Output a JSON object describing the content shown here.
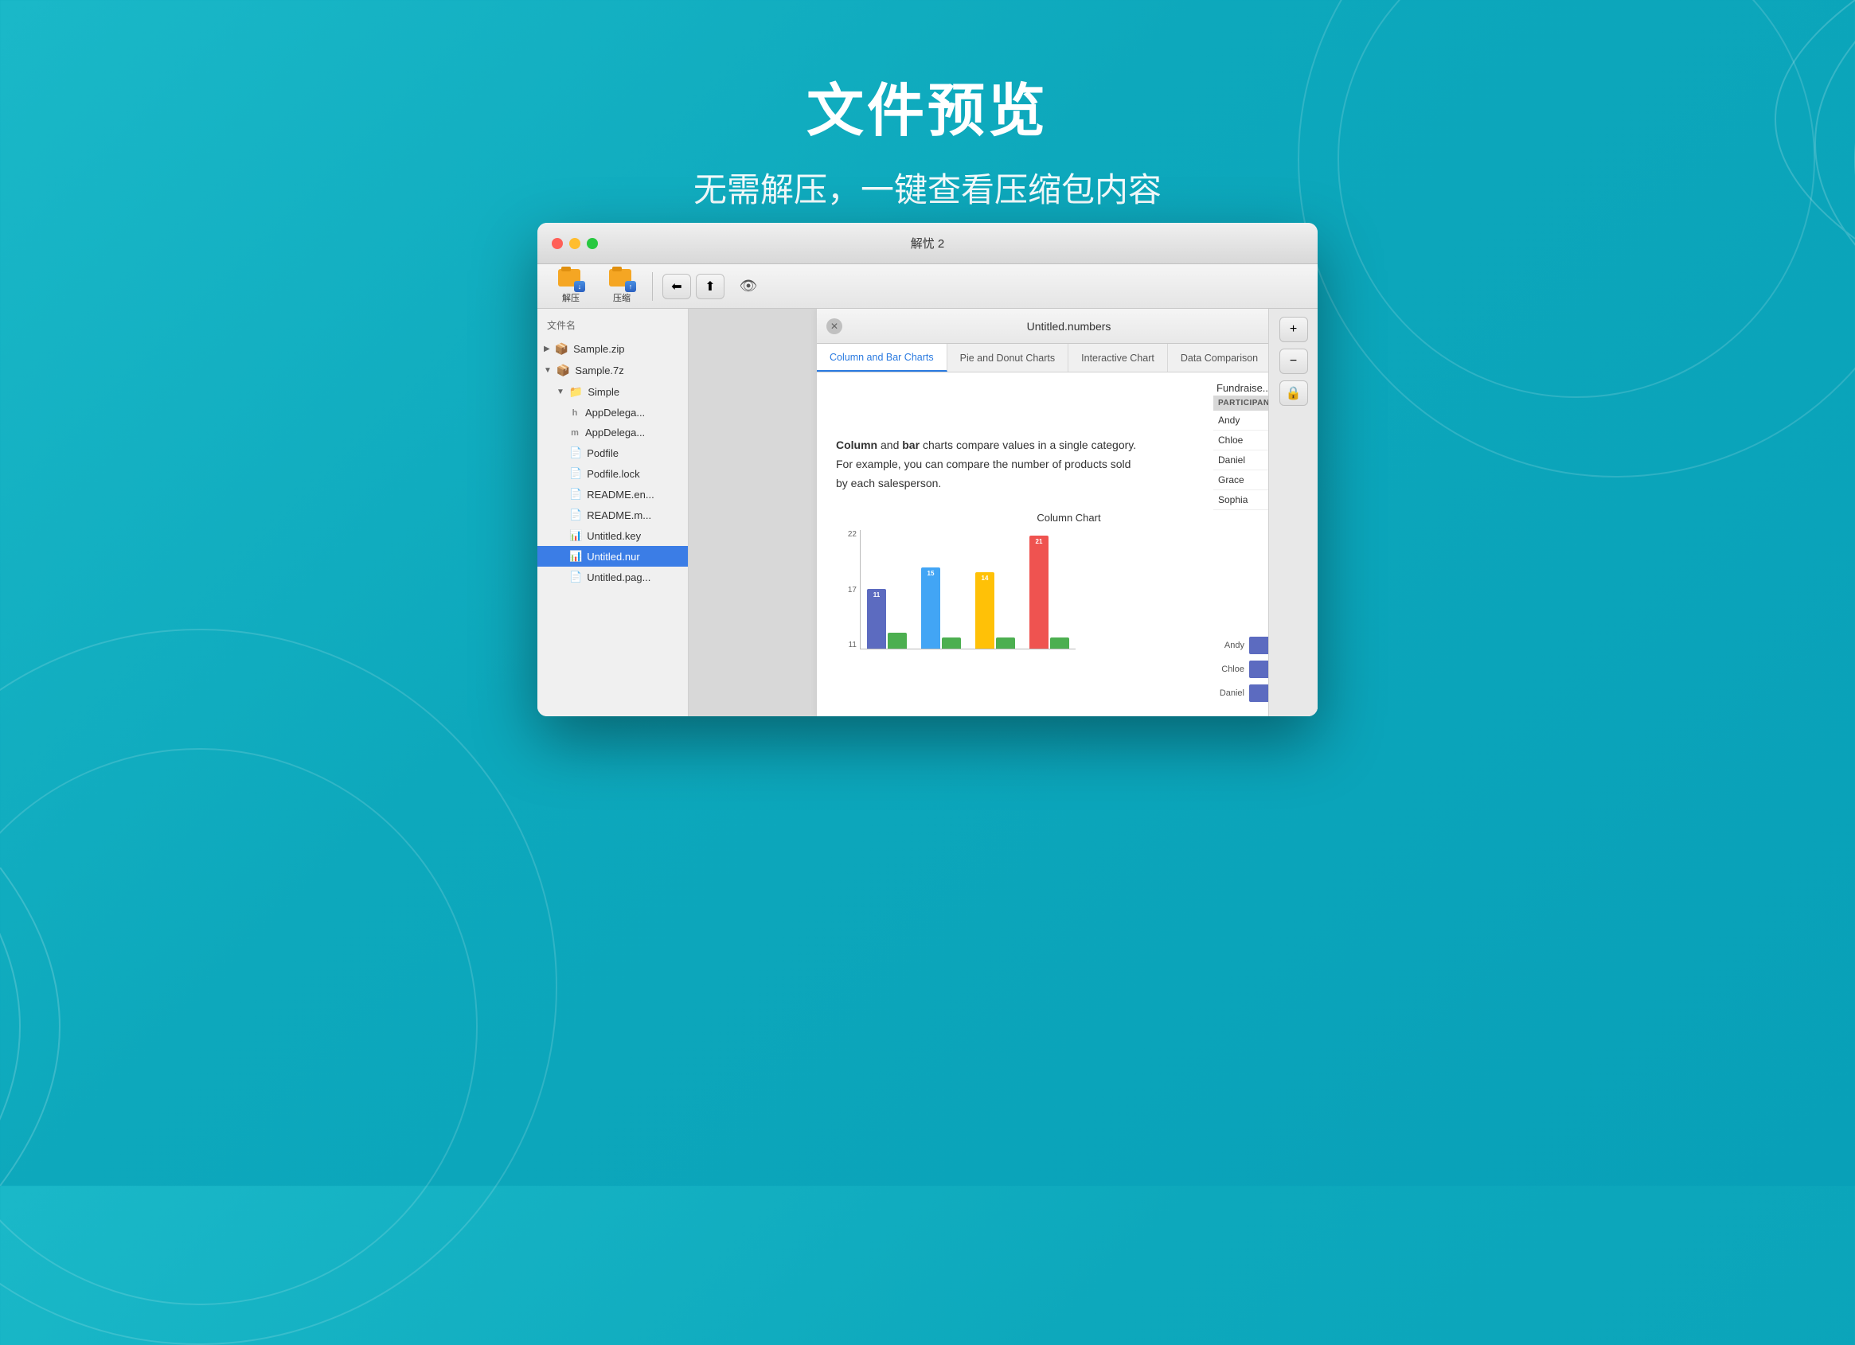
{
  "page": {
    "title": "文件预览",
    "subtitle": "无需解压，一键查看压缩包内容"
  },
  "main_window": {
    "title": "解忧 2"
  },
  "toolbar": {
    "decompress_label": "解压",
    "compress_label": "压缩"
  },
  "file_list": {
    "header": "文件名",
    "items": [
      {
        "name": "Sample.zip",
        "type": "zip",
        "indent": 0,
        "expanded": false
      },
      {
        "name": "Sample.7z",
        "type": "7z",
        "indent": 0,
        "expanded": true
      },
      {
        "name": "Simple",
        "type": "folder",
        "indent": 1,
        "expanded": true
      },
      {
        "name": "AppDelega...",
        "type": "h",
        "indent": 2
      },
      {
        "name": "AppDelega...",
        "type": "m",
        "indent": 2
      },
      {
        "name": "Podfile",
        "type": "file",
        "indent": 2
      },
      {
        "name": "Podfile.lock",
        "type": "file",
        "indent": 2
      },
      {
        "name": "README.en...",
        "type": "md",
        "indent": 2
      },
      {
        "name": "README.m...",
        "type": "md",
        "indent": 2
      },
      {
        "name": "Untitled.key",
        "type": "key",
        "indent": 2
      },
      {
        "name": "Untitled.nur",
        "type": "numbers",
        "indent": 2,
        "selected": true
      },
      {
        "name": "Untitled.pag...",
        "type": "pages",
        "indent": 2
      }
    ]
  },
  "numbers_window": {
    "title": "Untitled.numbers",
    "close_label": "✕",
    "tabs": [
      {
        "label": "Column and Bar Charts",
        "active": true
      },
      {
        "label": "Pie and Donut Charts",
        "active": false
      },
      {
        "label": "Interactive Chart",
        "active": false
      },
      {
        "label": "Data Comparison",
        "active": false
      }
    ],
    "description": "Column and bar charts compare values in a single category. For example, you can compare the number of products sold by each salesperson.",
    "chart_title": "Column Chart",
    "chart": {
      "y_labels": [
        "22",
        "17",
        "11"
      ],
      "bar_groups": [
        {
          "bars": [
            {
              "value": 11,
              "color": "#5c6bc0",
              "label": "11",
              "height_pct": 50
            },
            {
              "value": 3,
              "color": "#4caf50",
              "label": "",
              "height_pct": 14
            }
          ]
        },
        {
          "bars": [
            {
              "value": 15,
              "color": "#42a5f5",
              "label": "15",
              "height_pct": 68
            },
            {
              "value": 2,
              "color": "#4caf50",
              "label": "",
              "height_pct": 9
            }
          ]
        },
        {
          "bars": [
            {
              "value": 14,
              "color": "#ffc107",
              "label": "14",
              "height_pct": 64
            },
            {
              "value": 2,
              "color": "#4caf50",
              "label": "",
              "height_pct": 9
            }
          ]
        },
        {
          "bars": [
            {
              "value": 21,
              "color": "#ef5350",
              "label": "21",
              "height_pct": 95
            },
            {
              "value": 2,
              "color": "#4caf50",
              "label": "",
              "height_pct": 9
            }
          ]
        }
      ]
    },
    "fundraiser": {
      "title": "Fundraise...",
      "col_header": "PARTICIPANT",
      "rows": [
        "Andy",
        "Chloe",
        "Daniel",
        "Grace",
        "Sophia"
      ]
    },
    "bar_chart_right": {
      "participants": [
        {
          "name": "Andy",
          "width": 85
        },
        {
          "name": "Chloe",
          "width": 75
        },
        {
          "name": "Daniel",
          "width": 65
        }
      ]
    }
  },
  "right_toolbar": {
    "plus_label": "+",
    "minus_label": "−",
    "lock_label": "🔒"
  }
}
